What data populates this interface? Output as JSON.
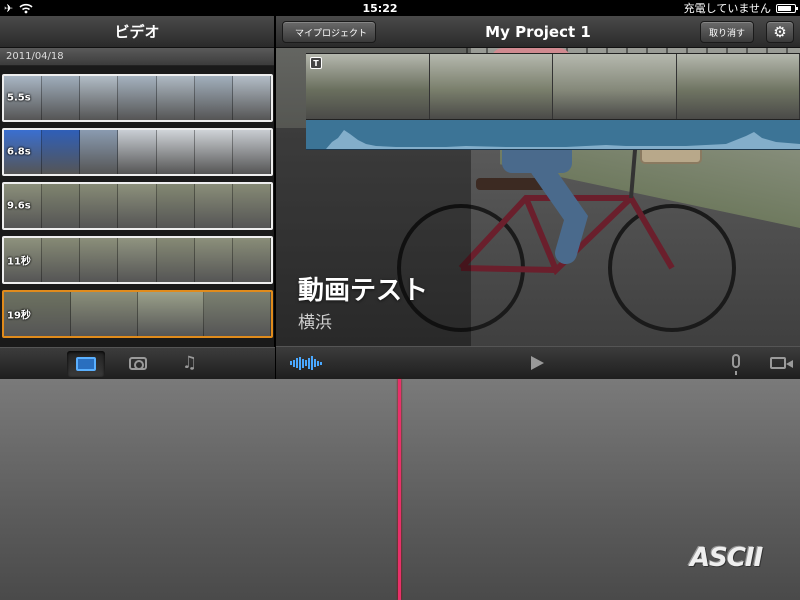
{
  "status_bar": {
    "time": "15:22",
    "charging_text": "充電していません",
    "battery_level": 0.8
  },
  "left_panel": {
    "title": "ビデオ",
    "date_header": "2011/04/18",
    "clips": [
      {
        "duration": "5.5s",
        "frame_colors": [
          "#a9b6c4",
          "#9fadbb",
          "#b1bcc6",
          "#a5b2bf",
          "#aeb9c3",
          "#a2afbc",
          "#b3bdc7"
        ]
      },
      {
        "duration": "6.8s",
        "frame_colors": [
          "#3a6fd0",
          "#2f5fb8",
          "#8a9bb0",
          "#c9ced4",
          "#d0d4d8",
          "#cfd3d7",
          "#c8ccd1"
        ]
      },
      {
        "duration": "9.6s",
        "frame_colors": [
          "#8b8f7a",
          "#7f846f",
          "#878b76",
          "#8d917c",
          "#838872",
          "#8a8e79",
          "#868a75"
        ]
      },
      {
        "duration": "11秒",
        "frame_colors": [
          "#8e927d",
          "#868a75",
          "#8b8f7a",
          "#909480",
          "#868a75",
          "#8c907b",
          "#898d78"
        ]
      },
      {
        "duration": "19秒",
        "frame_colors": [
          "#6d7260",
          "#8a8f7a",
          "#9aa08a",
          "#7b8070"
        ]
      }
    ],
    "tabs": [
      {
        "name": "video",
        "active": true
      },
      {
        "name": "photo",
        "active": false
      },
      {
        "name": "music",
        "active": false
      }
    ]
  },
  "header": {
    "back_label": "マイプロジェクト",
    "project_title": "My Project 1",
    "undo_label": "取り消す",
    "settings_icon": "gear-icon"
  },
  "viewer": {
    "title_text": "動画テスト",
    "subtitle_text": "横浜"
  },
  "timeline": {
    "frame_colors": [
      "#6a6f5e",
      "#7a7f6c",
      "#85897a",
      "#707563"
    ],
    "title_badge": "T",
    "playhead_color": "#e8306a",
    "audio_color": "#3c7496"
  },
  "watermark": "ASCII",
  "accent_color": "#e08b1c"
}
